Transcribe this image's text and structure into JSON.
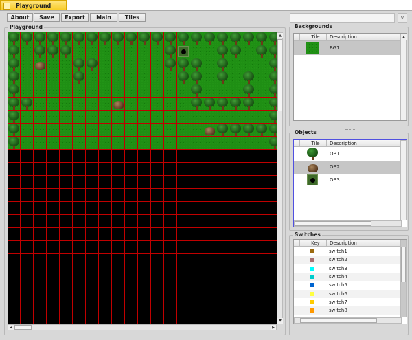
{
  "window": {
    "title": "Playground Editor"
  },
  "toolbar": {
    "about": "About",
    "save": "Save",
    "export": "Export",
    "main": "Main",
    "tiles": "Tiles"
  },
  "search": {
    "value": "",
    "dropdown": "v"
  },
  "playground": {
    "label": "Playground",
    "map": [
      "TTTTTTTTTTTTTTTTTTTTT",
      "T.TTT.......TH..TT.TT",
      "T.R..TT.....TTT.T...T",
      "T....T.......TT.T.T.T",
      "T.............T...T.T",
      "TT......R.....TTTTT.T",
      "T...................T",
      "T..............RTTTTT",
      "T...................T"
    ],
    "total_rows": 23
  },
  "backgrounds": {
    "label": "Backgrounds",
    "columns": [
      "Tile",
      "Description"
    ],
    "rows": [
      {
        "tile": "grass",
        "description": "BG1",
        "selected": true
      }
    ]
  },
  "objects": {
    "label": "Objects",
    "columns": [
      "Tile",
      "Description"
    ],
    "rows": [
      {
        "tile": "tree",
        "description": "OB1"
      },
      {
        "tile": "rock",
        "description": "OB2",
        "selected": true
      },
      {
        "tile": "hole",
        "description": "OB3"
      }
    ]
  },
  "switches": {
    "label": "Switches",
    "columns": [
      "Key",
      "Description"
    ],
    "rows": [
      {
        "color": "#9c6a10",
        "description": "switch1"
      },
      {
        "color": "#a87070",
        "description": "switch2"
      },
      {
        "color": "#00ffff",
        "description": "switch3"
      },
      {
        "color": "#00cccc",
        "description": "switch4"
      },
      {
        "color": "#0064d0",
        "description": "switch5"
      },
      {
        "color": "#ffff40",
        "description": "switch6"
      },
      {
        "color": "#ffcc00",
        "description": "switch7"
      },
      {
        "color": "#ff9900",
        "description": "switch8"
      },
      {
        "color": "#ff6600",
        "description": "treasure"
      }
    ]
  }
}
